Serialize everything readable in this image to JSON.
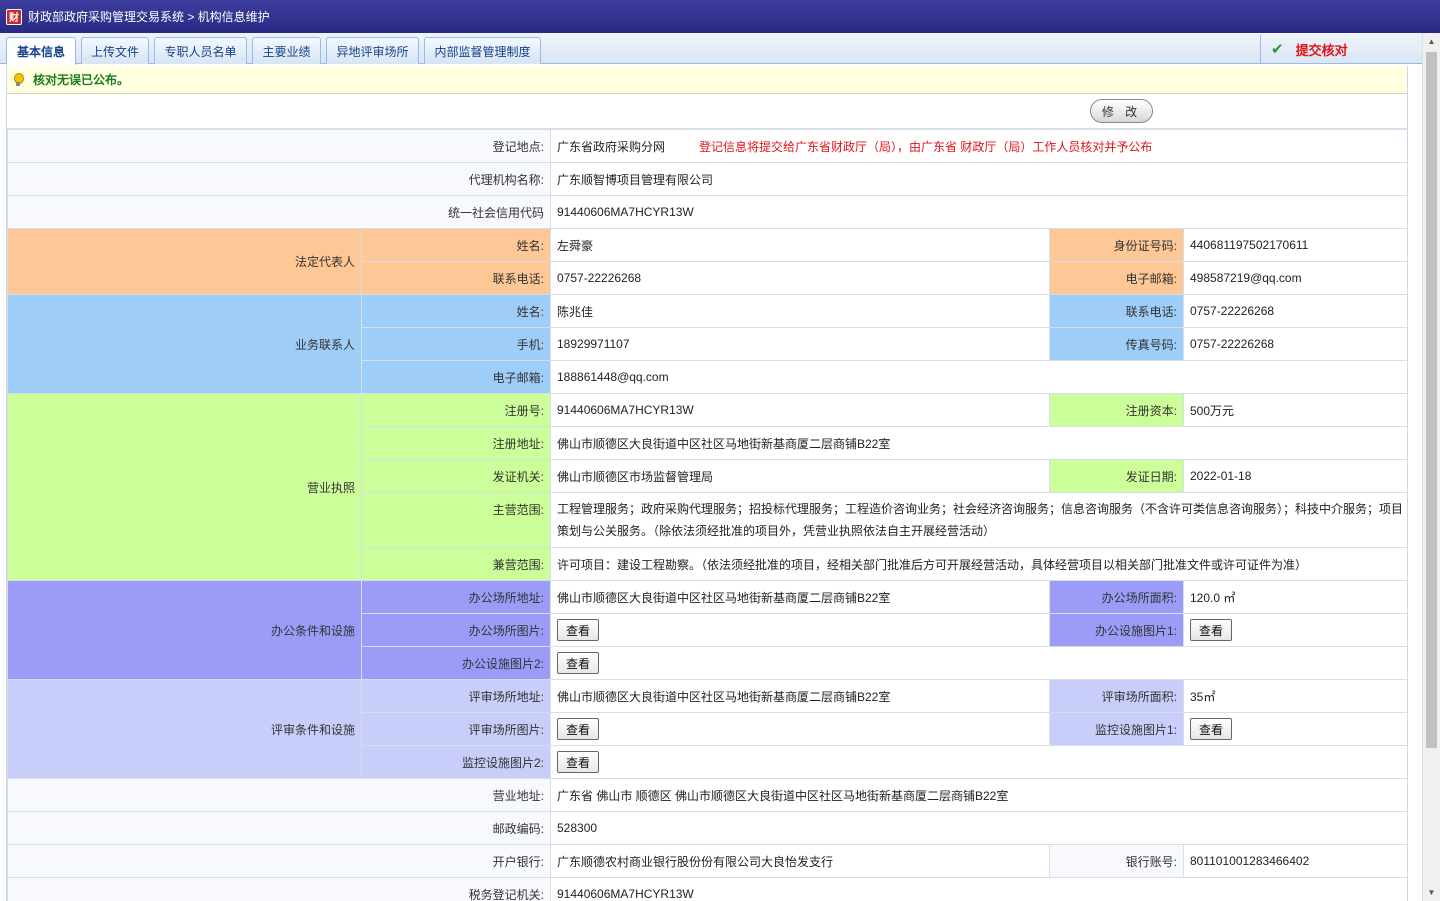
{
  "window": {
    "title": "财政部政府采购管理交易系统 > 机构信息维护",
    "icon_glyph": "财"
  },
  "tabs": [
    {
      "label": "基本信息",
      "active": true
    },
    {
      "label": "上传文件"
    },
    {
      "label": "专职人员名单"
    },
    {
      "label": "主要业绩"
    },
    {
      "label": "异地评审场所"
    },
    {
      "label": "内部监督管理制度"
    }
  ],
  "submit": {
    "label": "提交核对",
    "icon": "check-icon"
  },
  "notice": {
    "text": "核对无误已公布。",
    "icon": "lightbulb-icon"
  },
  "edit_button": "修 改",
  "view_label": "查看",
  "form": {
    "reg_location": {
      "label": "登记地点:",
      "value": "广东省政府采购分网",
      "note": "登记信息将提交给广东省财政厅（局），由广东省 财政厅（局）工作人员核对并予公布"
    },
    "agency_name": {
      "label": "代理机构名称:",
      "value": "广东顺智博项目管理有限公司"
    },
    "credit_code": {
      "label": "统一社会信用代码",
      "value": "91440606MA7HCYR13W"
    },
    "legal_rep": {
      "group": "法定代表人",
      "name_label": "姓名:",
      "name": "左舜豪",
      "id_label": "身份证号码:",
      "id": "440681197502170611",
      "phone_label": "联系电话:",
      "phone": "0757-22226268",
      "email_label": "电子邮箱:",
      "email": "498587219@qq.com"
    },
    "contact": {
      "group": "业务联系人",
      "name_label": "姓名:",
      "name": "陈兆佳",
      "phone_label": "联系电话:",
      "phone": "0757-22226268",
      "mobile_label": "手机:",
      "mobile": "18929971107",
      "fax_label": "传真号码:",
      "fax": "0757-22226268",
      "email_label": "电子邮箱:",
      "email": "188861448@qq.com"
    },
    "license": {
      "group": "营业执照",
      "reg_no_label": "注册号:",
      "reg_no": "91440606MA7HCYR13W",
      "capital_label": "注册资本:",
      "capital": "500万元",
      "address_label": "注册地址:",
      "address": "佛山市顺德区大良街道中区社区马地街新基商厦二层商铺B22室",
      "issuer_label": "发证机关:",
      "issuer": "佛山市顺德区市场监督管理局",
      "issue_date_label": "发证日期:",
      "issue_date": "2022-01-18",
      "main_scope_label": "主营范围:",
      "main_scope": "工程管理服务；政府采购代理服务；招投标代理服务；工程造价咨询业务；社会经济咨询服务；信息咨询服务（不含许可类信息咨询服务）；科技中介服务；项目策划与公关服务。（除依法须经批准的项目外，凭营业执照依法自主开展经营活动）",
      "side_scope_label": "兼营范围:",
      "side_scope": "许可项目：建设工程勘察。（依法须经批准的项目，经相关部门批准后方可开展经营活动，具体经营项目以相关部门批准文件或许可证件为准）"
    },
    "office": {
      "group": "办公条件和设施",
      "address_label": "办公场所地址:",
      "address": "佛山市顺德区大良街道中区社区马地街新基商厦二层商铺B22室",
      "area_label": "办公场所面积:",
      "area": "120.0 ㎡",
      "photo_label": "办公场所图片:",
      "facility1_label": "办公设施图片1:",
      "facility2_label": "办公设施图片2:"
    },
    "review": {
      "group": "评审条件和设施",
      "address_label": "评审场所地址:",
      "address": "佛山市顺德区大良街道中区社区马地街新基商厦二层商铺B22室",
      "area_label": "评审场所面积:",
      "area": "35㎡",
      "photo_label": "评审场所图片:",
      "monitor1_label": "监控设施图片1:",
      "monitor2_label": "监控设施图片2:"
    },
    "business_address": {
      "label": "营业地址:",
      "value": "广东省 佛山市 顺德区 佛山市顺德区大良街道中区社区马地街新基商厦二层商铺B22室"
    },
    "postcode": {
      "label": "邮政编码:",
      "value": "528300"
    },
    "bank": {
      "label": "开户银行:",
      "value": "广东顺德农村商业银行股份份有限公司大良怡发支行",
      "account_label": "银行账号:",
      "account": "801101001283466402"
    },
    "tax_authority": {
      "label": "税务登记机关:",
      "value": "91440606MA7HCYR13W"
    }
  }
}
